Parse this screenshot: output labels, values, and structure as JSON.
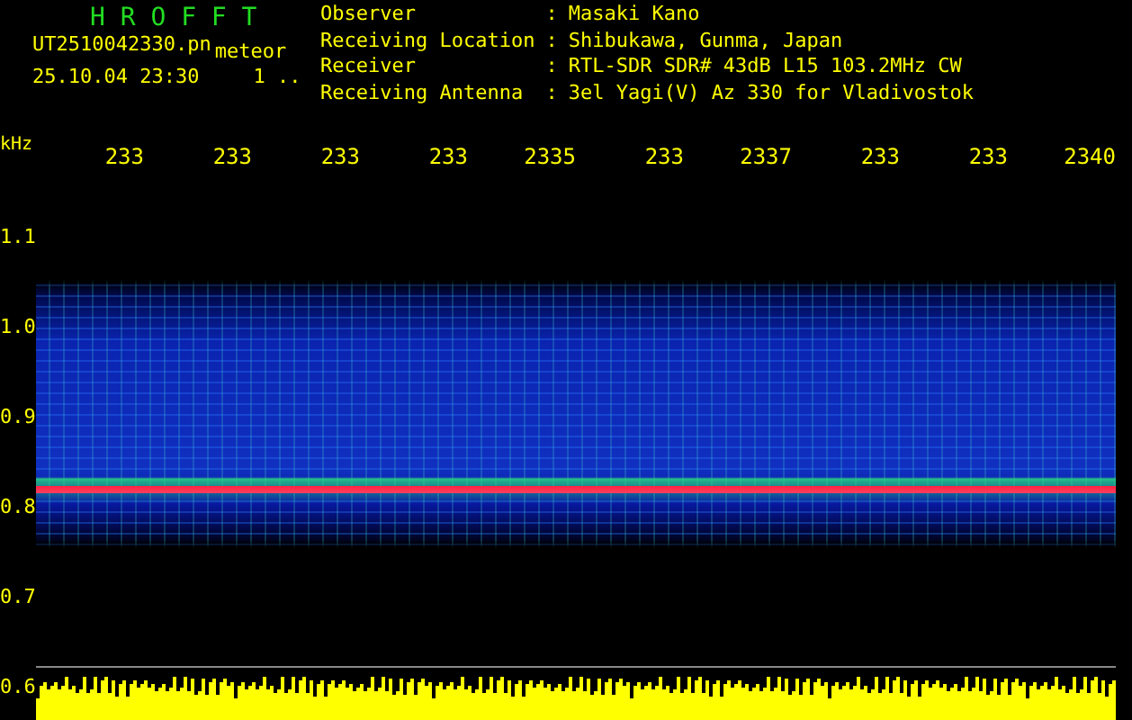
{
  "title": "H R O F F T",
  "file": {
    "name": "UT2510042330.pn",
    "tag": "meteor",
    "datetime": "25.10.04 23:30",
    "counter": "1 .."
  },
  "station": [
    {
      "label": "Observer",
      "separator": ":",
      "value": "Masaki Kano"
    },
    {
      "label": "Receiving Location",
      "separator": ":",
      "value": "Shibukawa, Gunma, Japan"
    },
    {
      "label": "Receiver",
      "separator": ":",
      "value": "RTL-SDR SDR# 43dB L15 103.2MHz CW"
    },
    {
      "label": "Receiving Antenna",
      "separator": ":",
      "value": "3el Yagi(V) Az 330 for Vladivostok"
    }
  ],
  "y_unit": "kHz",
  "time_labels": [
    "233",
    "233",
    "233",
    "233",
    "2335",
    "233",
    "2337",
    "233",
    "233",
    "2340"
  ],
  "y_labels": [
    "1.1",
    "1.0",
    "0.9",
    "0.8",
    "0.7",
    "0.6"
  ]
}
